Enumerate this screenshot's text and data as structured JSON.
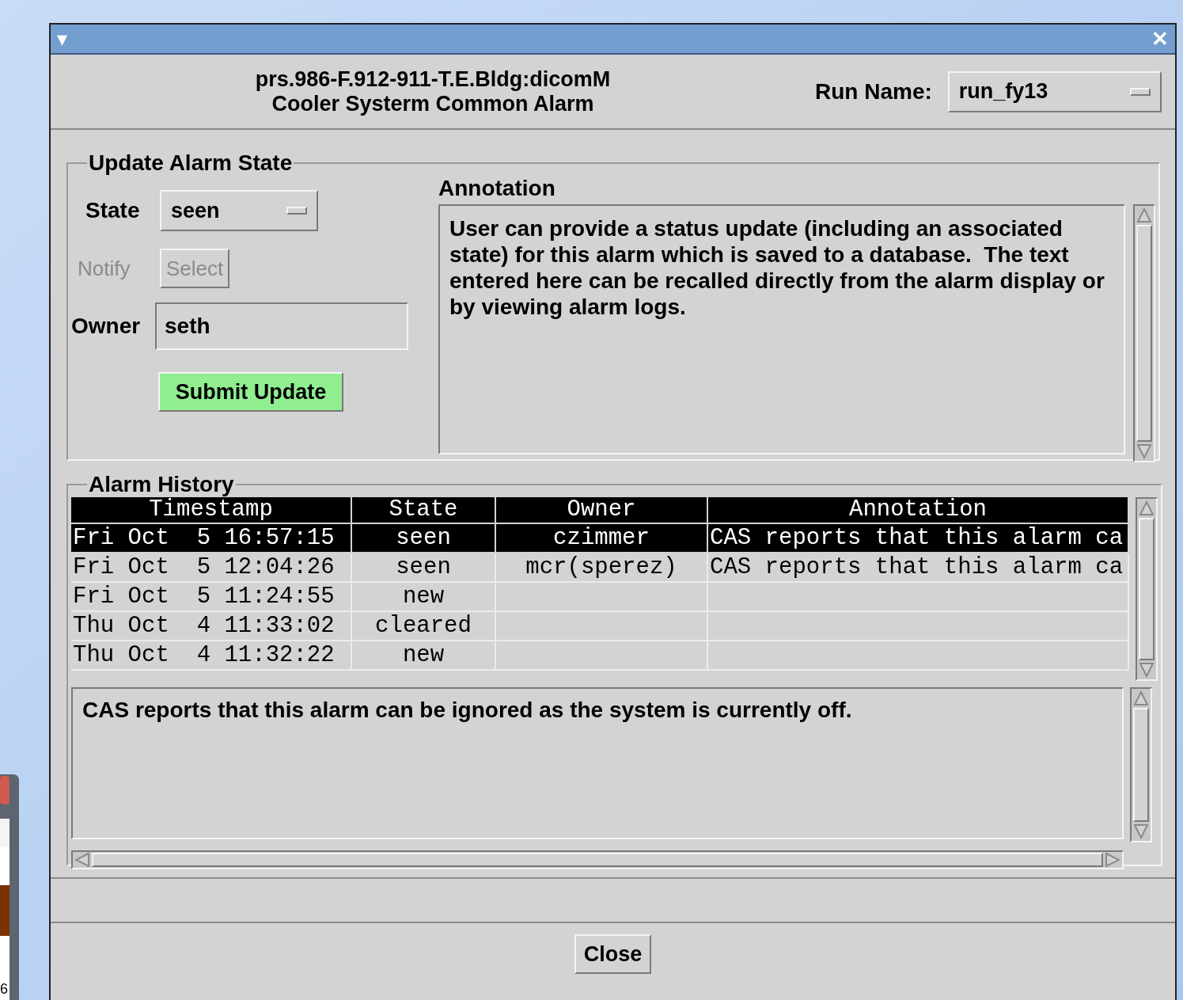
{
  "background_window": {
    "text": "6"
  },
  "window": {
    "menu_glyph": "▾",
    "close_glyph": "✕"
  },
  "header": {
    "lines": [
      "prs.986-F.912-911-T.E.Bldg:dicomM",
      "Cooler Systerm Common Alarm"
    ],
    "run_name": {
      "label": "Run Name:",
      "value": "run_fy13"
    }
  },
  "update_group": {
    "title": "Update Alarm State",
    "state": {
      "label": "State",
      "value": "seen"
    },
    "notify": {
      "label": "Notify",
      "button": "Select",
      "disabled": true
    },
    "owner": {
      "label": "Owner",
      "value": "seth"
    },
    "submit": "Submit Update",
    "annotation": {
      "label": "Annotation",
      "value": "User can provide a status update (including an associated state) for this alarm which is saved to a database.  The text entered here can be recalled directly from the alarm display or by viewing alarm logs."
    }
  },
  "history_group": {
    "title": "Alarm History",
    "columns": [
      "Timestamp",
      "State",
      "Owner",
      "Annotation"
    ],
    "rows": [
      {
        "cells": [
          "Fri Oct  5 16:57:15",
          "seen",
          "czimmer",
          "CAS reports that this alarm ca"
        ],
        "selected": true
      },
      {
        "cells": [
          "Fri Oct  5 12:04:26",
          "seen",
          "mcr(sperez)",
          "CAS reports that this alarm ca"
        ],
        "selected": false
      },
      {
        "cells": [
          "Fri Oct  5 11:24:55",
          "new",
          "",
          ""
        ],
        "selected": false
      },
      {
        "cells": [
          "Thu Oct  4 11:33:02",
          "cleared",
          "",
          ""
        ],
        "selected": false
      },
      {
        "cells": [
          "Thu Oct  4 11:32:22",
          "new",
          "",
          ""
        ],
        "selected": false
      }
    ],
    "detail": "CAS reports that this alarm can be ignored as the system is currently off."
  },
  "close_button": "Close"
}
